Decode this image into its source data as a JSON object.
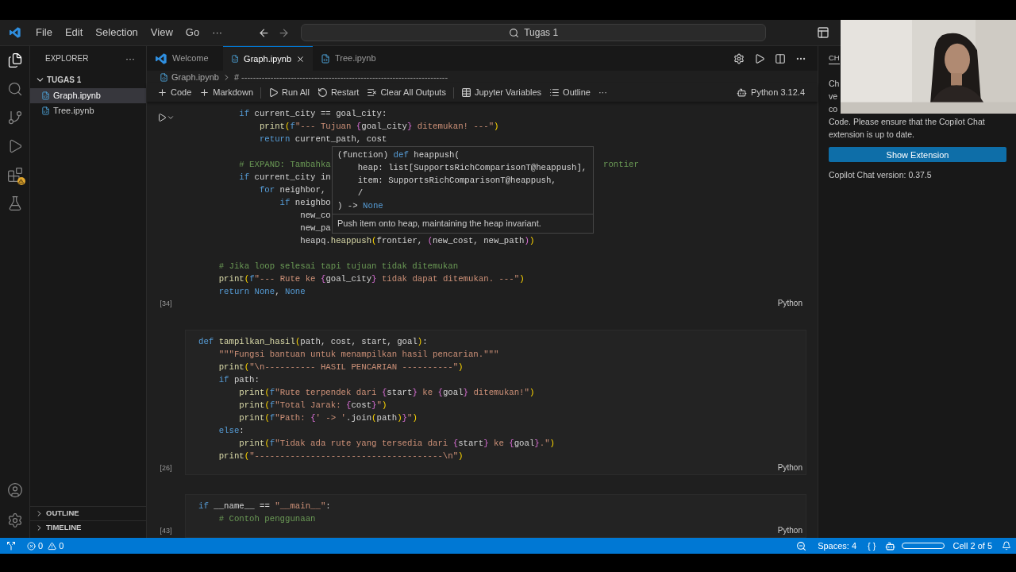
{
  "menu": [
    "File",
    "Edit",
    "Selection",
    "View",
    "Go",
    "···"
  ],
  "command_center": "Tugas 1",
  "activity_bar": [
    {
      "kind": "files",
      "selected": true
    },
    {
      "kind": "search",
      "selected": false
    },
    {
      "kind": "source",
      "selected": false
    },
    {
      "kind": "run",
      "selected": false
    },
    {
      "kind": "extensions",
      "selected": false,
      "warning": true
    },
    {
      "kind": "testing",
      "selected": false
    }
  ],
  "sidebar": {
    "title": "EXPLORER",
    "more": "···",
    "folder": {
      "label": "TUGAS 1",
      "expanded": true,
      "children": [
        {
          "label": "Graph.ipynb",
          "selected": true
        },
        {
          "label": "Tree.ipynb",
          "selected": false
        }
      ]
    },
    "sections": [
      {
        "label": "OUTLINE",
        "expanded": false
      },
      {
        "label": "TIMELINE",
        "expanded": false
      }
    ]
  },
  "tabs": [
    {
      "label": "Welcome",
      "kind": "welcome",
      "selected": false
    },
    {
      "label": "Graph.ipynb",
      "kind": "notebook",
      "selected": true
    },
    {
      "label": "Tree.ipynb",
      "kind": "notebook",
      "selected": false
    }
  ],
  "breadcrumb": [
    "Graph.ipynb",
    "# -----------------------------------------------------------------------"
  ],
  "toolbar": [
    {
      "kind": "add",
      "label": "Code"
    },
    {
      "kind": "add",
      "label": "Markdown"
    },
    {
      "kind": "runall",
      "label": "Run All"
    },
    {
      "kind": "restart",
      "label": "Restart"
    },
    {
      "kind": "clear",
      "label": "Clear All Outputs"
    },
    {
      "kind": "variables",
      "label": "Jupyter Variables"
    },
    {
      "kind": "outline",
      "label": "Outline"
    },
    {
      "kind": "more",
      "label": "···"
    }
  ],
  "kernel": "Python 3.12.4",
  "cells": [
    {
      "count": "[34]",
      "lang": "Python",
      "focused": true,
      "lines": [
        {
          "children": [
            {
              "children": [
                {
                  "segs": [
                    {
                      "kind": "kw",
                      "text": "if"
                    },
                    {
                      "kind": "p",
                      "text": " current_city == goal_city:"
                    }
                  ],
                  "children": [
                    {
                      "segs": [
                        {
                          "kind": "fn",
                          "text": "print"
                        },
                        {
                          "kind": "pa",
                          "text": "("
                        },
                        {
                          "kind": "kw",
                          "text": "f"
                        },
                        {
                          "kind": "str",
                          "text": "\"--- Tujuan "
                        },
                        {
                          "kind": "br",
                          "text": "{"
                        },
                        {
                          "kind": "p",
                          "text": "goal_city"
                        },
                        {
                          "kind": "br",
                          "text": "}"
                        },
                        {
                          "kind": "str",
                          "text": " ditemukan! ---\""
                        },
                        {
                          "kind": "pa",
                          "text": ")"
                        }
                      ]
                    },
                    {
                      "segs": [
                        {
                          "kind": "kw",
                          "text": "return"
                        },
                        {
                          "kind": "p",
                          "text": " current_path, cost"
                        }
                      ]
                    }
                  ]
                },
                {
                  "blank_before": true,
                  "segs": [
                    {
                      "kind": "com",
                      "text": "# EXPAND: Tambahka"
                    }
                  ],
                  "right": [
                    {
                      "kind": "com",
                      "text": "rontier"
                    }
                  ]
                },
                {
                  "segs": [
                    {
                      "kind": "kw",
                      "text": "if"
                    },
                    {
                      "kind": "p",
                      "text": " current_city in"
                    }
                  ],
                  "children": [
                    {
                      "segs": [
                        {
                          "kind": "kw",
                          "text": "for"
                        },
                        {
                          "kind": "p",
                          "text": " neighbor,"
                        }
                      ],
                      "children": [
                        {
                          "segs": [
                            {
                              "kind": "kw",
                              "text": "if"
                            },
                            {
                              "kind": "p",
                              "text": " neighbo"
                            }
                          ],
                          "children": [
                            {
                              "segs": [
                                {
                                  "kind": "p",
                                  "text": "new_co"
                                }
                              ]
                            },
                            {
                              "segs": [
                                {
                                  "kind": "p",
                                  "text": "new_pa"
                                }
                              ]
                            },
                            {
                              "segs": [
                                {
                                  "kind": "p",
                                  "text": "heapq."
                                },
                                {
                                  "kind": "fn",
                                  "text": "heappush"
                                },
                                {
                                  "kind": "pa",
                                  "text": "("
                                },
                                {
                                  "kind": "p",
                                  "text": "frontier, "
                                },
                                {
                                  "kind": "br",
                                  "text": "("
                                },
                                {
                                  "kind": "p",
                                  "text": "new_cost, new_path"
                                },
                                {
                                  "kind": "br",
                                  "text": ")"
                                },
                                {
                                  "kind": "pa",
                                  "text": ")"
                                }
                              ]
                            }
                          ]
                        }
                      ]
                    }
                  ]
                }
              ]
            },
            {
              "blank_before": true,
              "segs": [
                {
                  "kind": "com",
                  "text": "# Jika loop selesai tapi tujuan tidak ditemukan"
                }
              ]
            },
            {
              "segs": [
                {
                  "kind": "fn",
                  "text": "print"
                },
                {
                  "kind": "pa",
                  "text": "("
                },
                {
                  "kind": "kw",
                  "text": "f"
                },
                {
                  "kind": "str",
                  "text": "\"--- Rute ke "
                },
                {
                  "kind": "br",
                  "text": "{"
                },
                {
                  "kind": "p",
                  "text": "goal_city"
                },
                {
                  "kind": "br",
                  "text": "}"
                },
                {
                  "kind": "str",
                  "text": " tidak dapat ditemukan. ---\""
                },
                {
                  "kind": "pa",
                  "text": ")"
                }
              ]
            },
            {
              "segs": [
                {
                  "kind": "kw",
                  "text": "return"
                },
                {
                  "kind": "kw",
                  "text": " None"
                },
                {
                  "kind": "p",
                  "text": ", "
                },
                {
                  "kind": "kw",
                  "text": "None"
                }
              ]
            }
          ]
        }
      ]
    },
    {
      "count": "[26]",
      "lang": "Python",
      "focused": false,
      "lines": [
        {
          "segs": [
            {
              "kind": "kw",
              "text": "def"
            },
            {
              "kind": "fn",
              "text": " tampilkan_hasil"
            },
            {
              "kind": "pa",
              "text": "("
            },
            {
              "kind": "p",
              "text": "path, cost, start, goal"
            },
            {
              "kind": "pa",
              "text": ")"
            },
            {
              "kind": "p",
              "text": ":"
            }
          ],
          "children": [
            {
              "segs": [
                {
                  "kind": "str",
                  "text": "\"\"\"Fungsi bantuan untuk menampilkan hasil pencarian.\"\"\""
                }
              ]
            },
            {
              "segs": [
                {
                  "kind": "fn",
                  "text": "print"
                },
                {
                  "kind": "pa",
                  "text": "("
                },
                {
                  "kind": "str",
                  "text": "\"\\n---------- HASIL PENCARIAN ----------\""
                },
                {
                  "kind": "pa",
                  "text": ")"
                }
              ]
            },
            {
              "segs": [
                {
                  "kind": "kw",
                  "text": "if"
                },
                {
                  "kind": "p",
                  "text": " path:"
                }
              ],
              "children": [
                {
                  "segs": [
                    {
                      "kind": "fn",
                      "text": "print"
                    },
                    {
                      "kind": "pa",
                      "text": "("
                    },
                    {
                      "kind": "kw",
                      "text": "f"
                    },
                    {
                      "kind": "str",
                      "text": "\"Rute terpendek dari "
                    },
                    {
                      "kind": "br",
                      "text": "{"
                    },
                    {
                      "kind": "p",
                      "text": "start"
                    },
                    {
                      "kind": "br",
                      "text": "}"
                    },
                    {
                      "kind": "str",
                      "text": " ke "
                    },
                    {
                      "kind": "br",
                      "text": "{"
                    },
                    {
                      "kind": "p",
                      "text": "goal"
                    },
                    {
                      "kind": "br",
                      "text": "}"
                    },
                    {
                      "kind": "str",
                      "text": " ditemukan!\""
                    },
                    {
                      "kind": "pa",
                      "text": ")"
                    }
                  ]
                },
                {
                  "segs": [
                    {
                      "kind": "fn",
                      "text": "print"
                    },
                    {
                      "kind": "pa",
                      "text": "("
                    },
                    {
                      "kind": "kw",
                      "text": "f"
                    },
                    {
                      "kind": "str",
                      "text": "\"Total Jarak: "
                    },
                    {
                      "kind": "br",
                      "text": "{"
                    },
                    {
                      "kind": "p",
                      "text": "cost"
                    },
                    {
                      "kind": "br",
                      "text": "}"
                    },
                    {
                      "kind": "str",
                      "text": "\""
                    },
                    {
                      "kind": "pa",
                      "text": ")"
                    }
                  ]
                },
                {
                  "segs": [
                    {
                      "kind": "fn",
                      "text": "print"
                    },
                    {
                      "kind": "pa",
                      "text": "("
                    },
                    {
                      "kind": "kw",
                      "text": "f"
                    },
                    {
                      "kind": "str",
                      "text": "\"Path: "
                    },
                    {
                      "kind": "br",
                      "text": "{"
                    },
                    {
                      "kind": "str",
                      "text": "' -> '"
                    },
                    {
                      "kind": "p",
                      "text": ".join"
                    },
                    {
                      "kind": "pa",
                      "text": "("
                    },
                    {
                      "kind": "p",
                      "text": "path"
                    },
                    {
                      "kind": "pa",
                      "text": ")"
                    },
                    {
                      "kind": "br",
                      "text": "}"
                    },
                    {
                      "kind": "str",
                      "text": "\""
                    },
                    {
                      "kind": "pa",
                      "text": ")"
                    }
                  ]
                }
              ]
            },
            {
              "segs": [
                {
                  "kind": "kw",
                  "text": "else"
                },
                {
                  "kind": "p",
                  "text": ":"
                }
              ],
              "children": [
                {
                  "segs": [
                    {
                      "kind": "fn",
                      "text": "print"
                    },
                    {
                      "kind": "pa",
                      "text": "("
                    },
                    {
                      "kind": "kw",
                      "text": "f"
                    },
                    {
                      "kind": "str",
                      "text": "\"Tidak ada rute yang tersedia dari "
                    },
                    {
                      "kind": "br",
                      "text": "{"
                    },
                    {
                      "kind": "p",
                      "text": "start"
                    },
                    {
                      "kind": "br",
                      "text": "}"
                    },
                    {
                      "kind": "str",
                      "text": " ke "
                    },
                    {
                      "kind": "br",
                      "text": "{"
                    },
                    {
                      "kind": "p",
                      "text": "goal"
                    },
                    {
                      "kind": "br",
                      "text": "}"
                    },
                    {
                      "kind": "str",
                      "text": ".\""
                    },
                    {
                      "kind": "pa",
                      "text": ")"
                    }
                  ]
                }
              ]
            },
            {
              "segs": [
                {
                  "kind": "fn",
                  "text": "print"
                },
                {
                  "kind": "pa",
                  "text": "("
                },
                {
                  "kind": "str",
                  "text": "\"-------------------------------------\\n\""
                },
                {
                  "kind": "pa",
                  "text": ")"
                }
              ]
            }
          ]
        }
      ]
    },
    {
      "count": "[43]",
      "lang": "Python",
      "focused": false,
      "lines": [
        {
          "segs": [
            {
              "kind": "kw",
              "text": "if"
            },
            {
              "kind": "p",
              "text": " __name__ == "
            },
            {
              "kind": "str",
              "text": "\"__main__\""
            },
            {
              "kind": "p",
              "text": ":"
            }
          ],
          "children": [
            {
              "segs": [
                {
                  "kind": "com",
                  "text": "# Contoh penggunaan"
                }
              ]
            }
          ]
        }
      ]
    }
  ],
  "hover": {
    "signature": [
      [
        {
          "kind": "p",
          "text": "(function) "
        },
        {
          "kind": "kw",
          "text": "def"
        },
        {
          "kind": "p",
          "text": " heappush("
        }
      ],
      [
        {
          "kind": "p",
          "text": "    heap: list[SupportsRichComparisonT@heappush],"
        }
      ],
      [
        {
          "kind": "p",
          "text": "    item: SupportsRichComparisonT@heappush,"
        }
      ],
      [
        {
          "kind": "p",
          "text": "    /"
        }
      ],
      [
        {
          "kind": "p",
          "text": ") -> "
        },
        {
          "kind": "kw",
          "text": "None"
        }
      ]
    ],
    "doc": "Push item onto heap, maintaining the heap invariant."
  },
  "chat": {
    "tab": "CH",
    "fragments": [
      "Ch",
      "ve",
      "co"
    ],
    "lines": [
      "Code. Please ensure that the Copilot Chat",
      "extension is up to date."
    ],
    "button": "Show Extension",
    "version": "Copilot Chat version: 0.37.5"
  },
  "webcam": {
    "kind": "picture"
  },
  "status": {
    "errors": "0",
    "warnings": "0",
    "spaces": "Spaces: 4",
    "braces": "{ }",
    "cell": "Cell 2 of 5"
  }
}
